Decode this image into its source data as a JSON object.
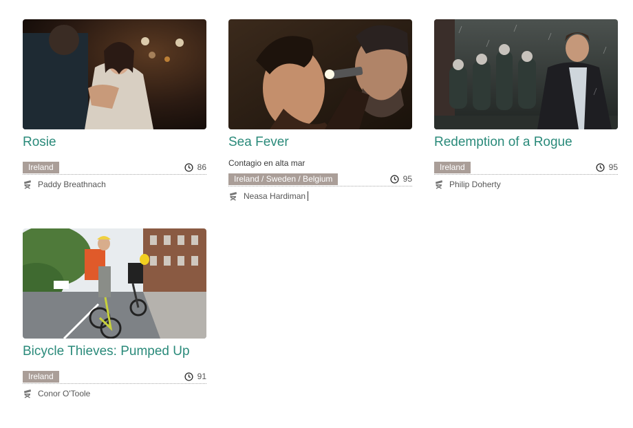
{
  "films": [
    {
      "title": "Rosie",
      "subtitle": "",
      "country": "Ireland",
      "runtime": "86",
      "director": "Paddy Breathnach",
      "thumb_alt": "Rosie still"
    },
    {
      "title": "Sea Fever",
      "subtitle": "Contagio en alta mar",
      "country": "Ireland / Sweden / Belgium",
      "runtime": "95",
      "director": "Neasa Hardiman",
      "thumb_alt": "Sea Fever still"
    },
    {
      "title": "Redemption of a Rogue",
      "subtitle": "",
      "country": "Ireland",
      "runtime": "95",
      "director": "Philip Doherty",
      "thumb_alt": "Redemption of a Rogue still"
    },
    {
      "title": "Bicycle Thieves: Pumped Up",
      "subtitle": "",
      "country": "Ireland",
      "runtime": "91",
      "director": "Conor O'Toole",
      "thumb_alt": "Bicycle Thieves: Pumped Up still"
    }
  ],
  "icons": {
    "runtime": "clock-icon",
    "director": "director-chair-icon"
  },
  "colors": {
    "title": "#2a8a7a",
    "badge": "#aa9e98"
  }
}
